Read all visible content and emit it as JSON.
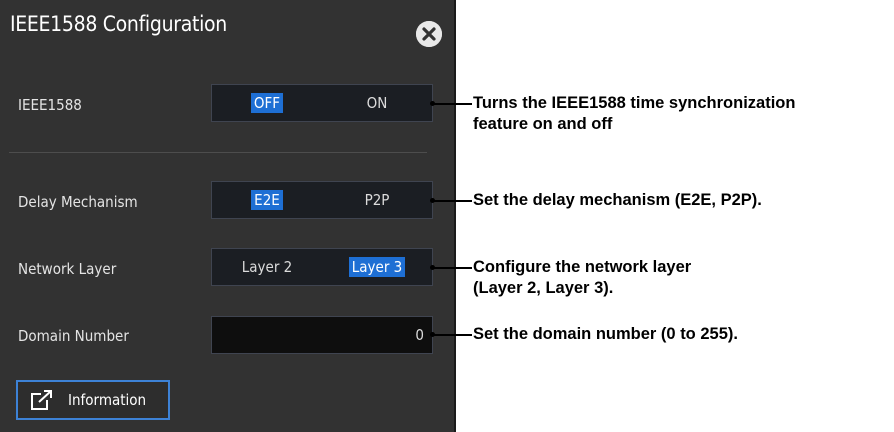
{
  "dialog": {
    "title": "IEEE1588 Configuration",
    "close_icon": "close-icon"
  },
  "settings": {
    "ieee1588": {
      "label": "IEEE1588",
      "options": [
        "OFF",
        "ON"
      ],
      "selected": "OFF"
    },
    "delay_mechanism": {
      "label": "Delay Mechanism",
      "options": [
        "E2E",
        "P2P"
      ],
      "selected": "E2E"
    },
    "network_layer": {
      "label": "Network Layer",
      "options": [
        "Layer 2",
        "Layer 3"
      ],
      "selected": "Layer 3"
    },
    "domain_number": {
      "label": "Domain Number",
      "value": "0"
    }
  },
  "information_button": {
    "label": "Information",
    "icon": "external-link-icon"
  },
  "annotations": {
    "ieee1588": [
      "Turns the IEEE1588 time synchronization",
      "feature on and off"
    ],
    "delay_mechanism": [
      "Set the delay mechanism (E2E, P2P)."
    ],
    "network_layer": [
      "Configure the network layer",
      "(Layer 2, Layer 3)."
    ],
    "domain_number": [
      "Set the domain number (0 to 255)."
    ]
  },
  "colors": {
    "panel_bg": "#323232",
    "selected_bg": "#1e6fd4",
    "info_border": "#3d82d6"
  }
}
